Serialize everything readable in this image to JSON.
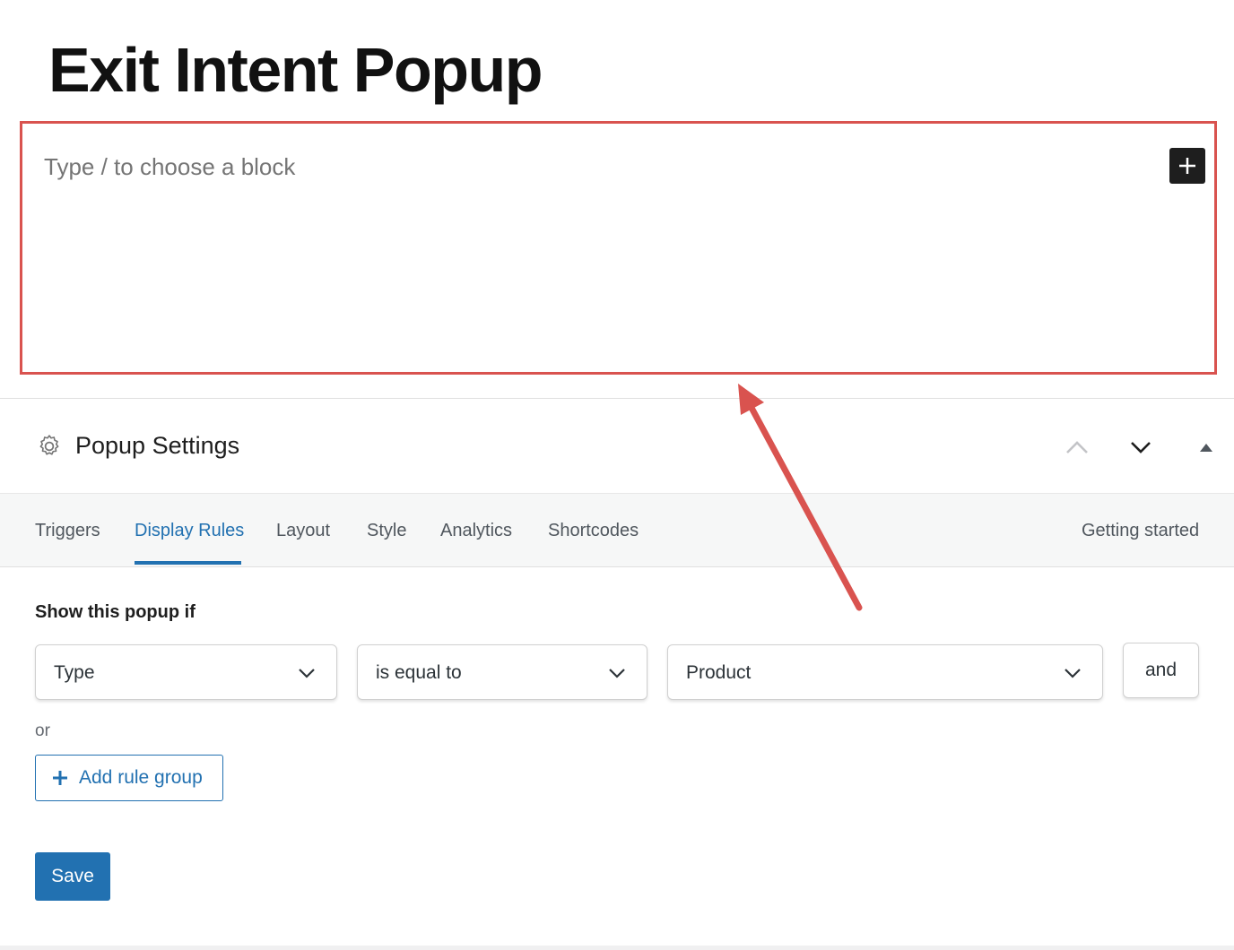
{
  "post": {
    "title": "Exit Intent Popup"
  },
  "editor": {
    "placeholder": "Type / to choose a block",
    "add_block_icon": "plus-icon"
  },
  "annotation": {
    "highlight_color": "#d9534f",
    "arrow_color": "#d9534f"
  },
  "panel": {
    "title": "Popup Settings",
    "icon": "gear-icon",
    "controls": [
      "move-up-icon",
      "move-down-icon",
      "toggle-panel-icon"
    ]
  },
  "tabs": {
    "items": [
      "Triggers",
      "Display Rules",
      "Layout",
      "Style",
      "Analytics",
      "Shortcodes"
    ],
    "active": "Display Rules",
    "help_link": "Getting started"
  },
  "rules": {
    "heading": "Show this popup if",
    "condition": {
      "field": "Type",
      "operator": "is equal to",
      "value": "Product"
    },
    "and_label": "and",
    "or_label": "or",
    "add_group_label": "Add rule group"
  },
  "actions": {
    "save_label": "Save"
  },
  "colors": {
    "accent": "#2271b1",
    "text": "#1e1e1e",
    "muted": "#757575"
  }
}
